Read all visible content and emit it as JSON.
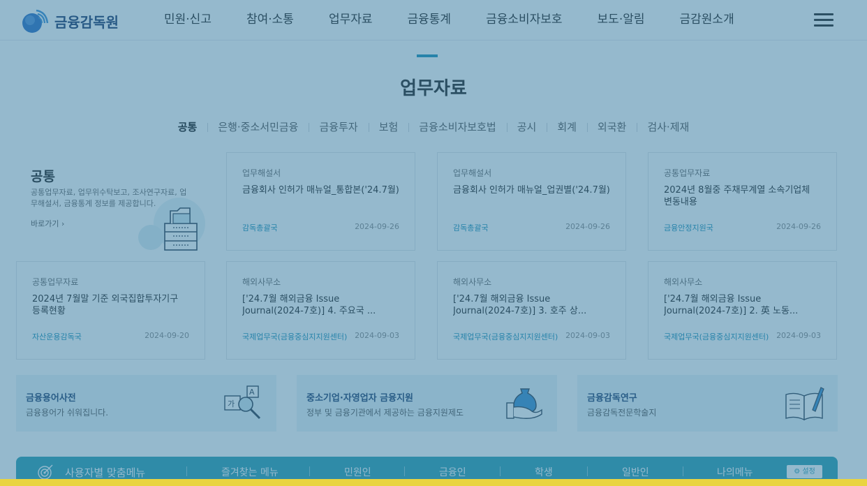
{
  "header": {
    "logo_text": "금융감독원",
    "nav": [
      "민원·신고",
      "참여·소통",
      "업무자료",
      "금융통계",
      "금융소비자보호",
      "보도·알림",
      "금감원소개"
    ]
  },
  "section": {
    "title": "업무자료",
    "tabs": [
      "공통",
      "은행·중소서민금융",
      "금융투자",
      "보험",
      "금융소비자보호법",
      "공시",
      "회계",
      "외국환",
      "검사·제재"
    ],
    "active_tab": "공통"
  },
  "intro": {
    "title": "공통",
    "desc": "공통업무자료, 업무위수탁보고, 조사연구자료, 업무해설서, 금융통계 정보를 제공합니다.",
    "link": "바로가기 ›"
  },
  "cards": [
    {
      "category": "업무해설서",
      "title": "금융회사 인허가 매뉴얼_통합본('24.7월)",
      "dept": "감독총괄국",
      "date": "2024-09-26"
    },
    {
      "category": "업무해설서",
      "title": "금융회사 인허가 매뉴얼_업권별('24.7월)",
      "dept": "감독총괄국",
      "date": "2024-09-26"
    },
    {
      "category": "공통업무자료",
      "title": "2024년 8월중 주채무계열 소속기업체 변동내용",
      "dept": "금융안정지원국",
      "date": "2024-09-26"
    },
    {
      "category": "공통업무자료",
      "title": "2024년 7월말 기준 외국집합투자기구 등록현황",
      "dept": "자산운용감독국",
      "date": "2024-09-20"
    },
    {
      "category": "해외사무소",
      "title": "['24.7월 해외금융 Issue Journal(2024-7호)] 4. 주요국 ...",
      "dept": "국제업무국(금융중심지지원센터)",
      "date": "2024-09-03"
    },
    {
      "category": "해외사무소",
      "title": "['24.7월 해외금융 Issue Journal(2024-7호)] 3. 호주 상...",
      "dept": "국제업무국(금융중심지지원센터)",
      "date": "2024-09-03"
    },
    {
      "category": "해외사무소",
      "title": "['24.7월 해외금융 Issue Journal(2024-7호)] 2. 英 노동...",
      "dept": "국제업무국(금융중심지지원센터)",
      "date": "2024-09-03"
    }
  ],
  "banners": [
    {
      "title": "금융용어사전",
      "desc": "금융용어가 쉬워집니다.",
      "icon": "dictionary-icon"
    },
    {
      "title": "중소기업·자영업자 금융지원",
      "desc": "정부 및 금융기관에서 제공하는 금융지원제도",
      "icon": "money-hand-icon"
    },
    {
      "title": "금융감독연구",
      "desc": "금융감독전문학술지",
      "icon": "book-pen-icon"
    }
  ],
  "usermenu": {
    "title": "사용자별 맞춤메뉴",
    "items": [
      "즐겨찾는 메뉴",
      "민원인",
      "금융인",
      "학생",
      "일반인",
      "나의메뉴"
    ],
    "setting": "설정"
  },
  "colors": {
    "accent": "#1a8fb6",
    "menu_bar": "#2b9fb2",
    "overlay": "#3478a0"
  }
}
